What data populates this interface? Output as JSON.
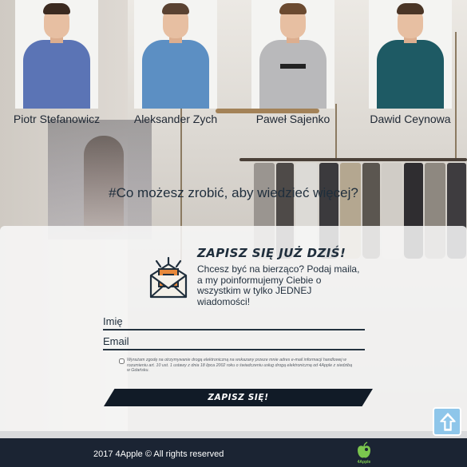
{
  "team": [
    {
      "name": "Piotr Stefanowicz",
      "shirt_color": "#5b74b5",
      "hair_color": "#3b2a20"
    },
    {
      "name": "Aleksander Zych",
      "shirt_color": "#5c8fc3",
      "hair_color": "#5a4232"
    },
    {
      "name": "Paweł Sajenko",
      "shirt_color": "#b9b9bb",
      "hair_color": "#6b4a30"
    },
    {
      "name": "Dawid Ceynowa",
      "shirt_color": "#1e5a64",
      "hair_color": "#4a3526"
    }
  ],
  "question": "#Co możesz zrobić, aby wiedzieć więcej?",
  "signup": {
    "title": "ZAPISZ SIĘ JUŻ DZIŚ!",
    "text": "Chcesz być na bierząco? Podaj maila, a my poinformujemy Ciebie o wszystkim w tylko JEDNEJ wiadomości!",
    "name_placeholder": "Imię",
    "email_placeholder": "Email",
    "consent": "Wyrażam zgodę na otrzymywanie drogą elektroniczną na wskazany przeze mnie adres e-mail informacji handlowej w rozumieniu art. 10 ust. 1 ustawy z dnia 18 lipca 2002 roku o świadczeniu usług drogą elektroniczną od 4Apple z siedzibą w Gdańsku.",
    "submit_label": "ZAPISZ SIĘ!",
    "icon": "envelope-icon"
  },
  "footer": {
    "copyright": "2017 4Apple © All rights reserved",
    "logo_label": "4Apple",
    "logo_icon": "apple-logo-icon"
  },
  "colors": {
    "navy": "#1f2e3c",
    "footer_bg": "#1b2433",
    "accent_orange": "#e8893a",
    "scroll_top": "#8ec6ea",
    "logo_green": "#7bc64e"
  }
}
